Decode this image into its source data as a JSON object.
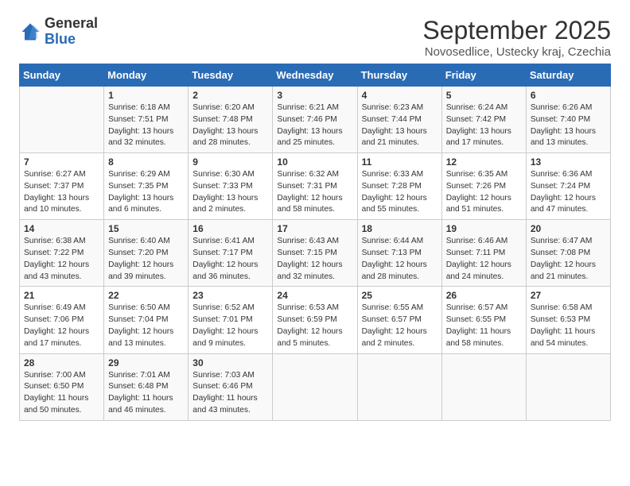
{
  "header": {
    "logo_general": "General",
    "logo_blue": "Blue",
    "title": "September 2025",
    "location": "Novosedlice, Ustecky kraj, Czechia"
  },
  "days_of_week": [
    "Sunday",
    "Monday",
    "Tuesday",
    "Wednesday",
    "Thursday",
    "Friday",
    "Saturday"
  ],
  "weeks": [
    [
      {
        "day": "",
        "content": ""
      },
      {
        "day": "1",
        "content": "Sunrise: 6:18 AM\nSunset: 7:51 PM\nDaylight: 13 hours\nand 32 minutes."
      },
      {
        "day": "2",
        "content": "Sunrise: 6:20 AM\nSunset: 7:48 PM\nDaylight: 13 hours\nand 28 minutes."
      },
      {
        "day": "3",
        "content": "Sunrise: 6:21 AM\nSunset: 7:46 PM\nDaylight: 13 hours\nand 25 minutes."
      },
      {
        "day": "4",
        "content": "Sunrise: 6:23 AM\nSunset: 7:44 PM\nDaylight: 13 hours\nand 21 minutes."
      },
      {
        "day": "5",
        "content": "Sunrise: 6:24 AM\nSunset: 7:42 PM\nDaylight: 13 hours\nand 17 minutes."
      },
      {
        "day": "6",
        "content": "Sunrise: 6:26 AM\nSunset: 7:40 PM\nDaylight: 13 hours\nand 13 minutes."
      }
    ],
    [
      {
        "day": "7",
        "content": "Sunrise: 6:27 AM\nSunset: 7:37 PM\nDaylight: 13 hours\nand 10 minutes."
      },
      {
        "day": "8",
        "content": "Sunrise: 6:29 AM\nSunset: 7:35 PM\nDaylight: 13 hours\nand 6 minutes."
      },
      {
        "day": "9",
        "content": "Sunrise: 6:30 AM\nSunset: 7:33 PM\nDaylight: 13 hours\nand 2 minutes."
      },
      {
        "day": "10",
        "content": "Sunrise: 6:32 AM\nSunset: 7:31 PM\nDaylight: 12 hours\nand 58 minutes."
      },
      {
        "day": "11",
        "content": "Sunrise: 6:33 AM\nSunset: 7:28 PM\nDaylight: 12 hours\nand 55 minutes."
      },
      {
        "day": "12",
        "content": "Sunrise: 6:35 AM\nSunset: 7:26 PM\nDaylight: 12 hours\nand 51 minutes."
      },
      {
        "day": "13",
        "content": "Sunrise: 6:36 AM\nSunset: 7:24 PM\nDaylight: 12 hours\nand 47 minutes."
      }
    ],
    [
      {
        "day": "14",
        "content": "Sunrise: 6:38 AM\nSunset: 7:22 PM\nDaylight: 12 hours\nand 43 minutes."
      },
      {
        "day": "15",
        "content": "Sunrise: 6:40 AM\nSunset: 7:20 PM\nDaylight: 12 hours\nand 39 minutes."
      },
      {
        "day": "16",
        "content": "Sunrise: 6:41 AM\nSunset: 7:17 PM\nDaylight: 12 hours\nand 36 minutes."
      },
      {
        "day": "17",
        "content": "Sunrise: 6:43 AM\nSunset: 7:15 PM\nDaylight: 12 hours\nand 32 minutes."
      },
      {
        "day": "18",
        "content": "Sunrise: 6:44 AM\nSunset: 7:13 PM\nDaylight: 12 hours\nand 28 minutes."
      },
      {
        "day": "19",
        "content": "Sunrise: 6:46 AM\nSunset: 7:11 PM\nDaylight: 12 hours\nand 24 minutes."
      },
      {
        "day": "20",
        "content": "Sunrise: 6:47 AM\nSunset: 7:08 PM\nDaylight: 12 hours\nand 21 minutes."
      }
    ],
    [
      {
        "day": "21",
        "content": "Sunrise: 6:49 AM\nSunset: 7:06 PM\nDaylight: 12 hours\nand 17 minutes."
      },
      {
        "day": "22",
        "content": "Sunrise: 6:50 AM\nSunset: 7:04 PM\nDaylight: 12 hours\nand 13 minutes."
      },
      {
        "day": "23",
        "content": "Sunrise: 6:52 AM\nSunset: 7:01 PM\nDaylight: 12 hours\nand 9 minutes."
      },
      {
        "day": "24",
        "content": "Sunrise: 6:53 AM\nSunset: 6:59 PM\nDaylight: 12 hours\nand 5 minutes."
      },
      {
        "day": "25",
        "content": "Sunrise: 6:55 AM\nSunset: 6:57 PM\nDaylight: 12 hours\nand 2 minutes."
      },
      {
        "day": "26",
        "content": "Sunrise: 6:57 AM\nSunset: 6:55 PM\nDaylight: 11 hours\nand 58 minutes."
      },
      {
        "day": "27",
        "content": "Sunrise: 6:58 AM\nSunset: 6:53 PM\nDaylight: 11 hours\nand 54 minutes."
      }
    ],
    [
      {
        "day": "28",
        "content": "Sunrise: 7:00 AM\nSunset: 6:50 PM\nDaylight: 11 hours\nand 50 minutes."
      },
      {
        "day": "29",
        "content": "Sunrise: 7:01 AM\nSunset: 6:48 PM\nDaylight: 11 hours\nand 46 minutes."
      },
      {
        "day": "30",
        "content": "Sunrise: 7:03 AM\nSunset: 6:46 PM\nDaylight: 11 hours\nand 43 minutes."
      },
      {
        "day": "",
        "content": ""
      },
      {
        "day": "",
        "content": ""
      },
      {
        "day": "",
        "content": ""
      },
      {
        "day": "",
        "content": ""
      }
    ]
  ]
}
